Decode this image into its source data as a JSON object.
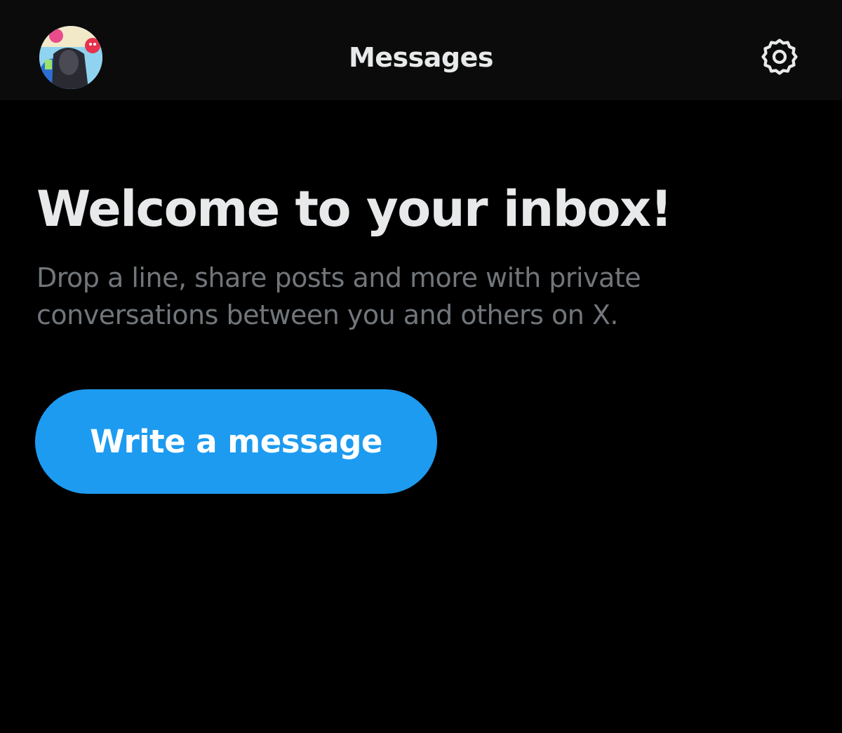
{
  "header": {
    "title": "Messages",
    "avatar_icon": "profile-avatar",
    "settings_icon": "gear-icon"
  },
  "empty_state": {
    "title": "Welcome to your inbox!",
    "description": "Drop a line, share posts and more with private conversations between you and others on X."
  },
  "actions": {
    "write_message_label": "Write a message"
  },
  "colors": {
    "background": "#000000",
    "header_background": "#0b0b0b",
    "primary_text": "#e7e9ea",
    "secondary_text": "#71767b",
    "accent": "#1d9bf0"
  }
}
